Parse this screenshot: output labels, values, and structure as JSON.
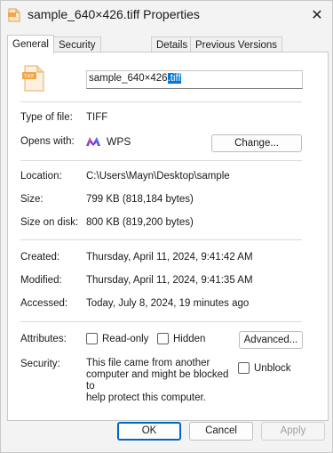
{
  "window": {
    "title": "sample_640×426.tiff Properties"
  },
  "tabs": [
    {
      "label": "General"
    },
    {
      "label": "Security"
    },
    {
      "label": "Details"
    },
    {
      "label": "Previous Versions"
    }
  ],
  "general": {
    "filename_base": "sample_640×426",
    "filename_ext": ".tiff",
    "type_label": "Type of file:",
    "type_value": "TIFF",
    "opens_label": "Opens with:",
    "opens_value": "WPS",
    "change_button": "Change...",
    "location_label": "Location:",
    "location_value": "C:\\Users\\Mayn\\Desktop\\sample",
    "size_label": "Size:",
    "size_value": "799 KB (818,184 bytes)",
    "size_on_disk_label": "Size on disk:",
    "size_on_disk_value": "800 KB (819,200 bytes)",
    "created_label": "Created:",
    "created_value": "Thursday, April 11, 2024, 9:41:42 AM",
    "modified_label": "Modified:",
    "modified_value": "Thursday, April 11, 2024, 9:41:35 AM",
    "accessed_label": "Accessed:",
    "accessed_value": "Today, July 8, 2024, 19 minutes ago",
    "attributes_label": "Attributes:",
    "readonly_label": "Read-only",
    "hidden_label": "Hidden",
    "advanced_button": "Advanced...",
    "security_label": "Security:",
    "security_text_1": "This file came from another",
    "security_text_2": "computer and might be blocked to",
    "security_text_3": "help protect this computer.",
    "unblock_label": "Unblock"
  },
  "footer": {
    "ok": "OK",
    "cancel": "Cancel",
    "apply": "Apply"
  },
  "colors": {
    "selection": "#0078d7",
    "accent": "#0067c0",
    "wps_icon": "#7b3fe4"
  }
}
